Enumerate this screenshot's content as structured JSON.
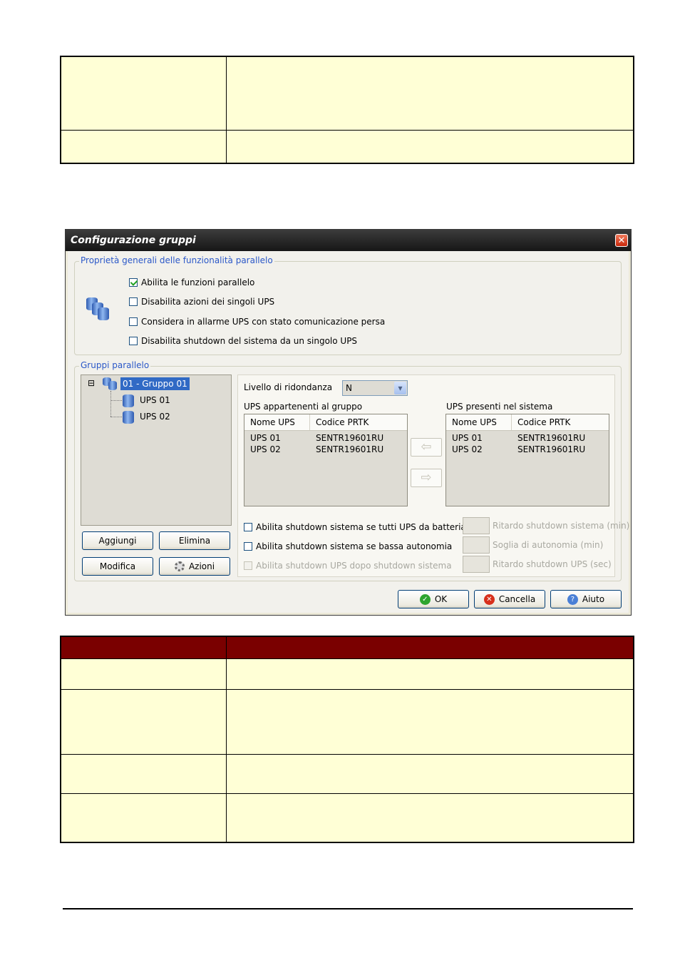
{
  "dialog": {
    "title": "Configurazione gruppi",
    "close_glyph": "✕",
    "general_section": {
      "legend": "Proprietà generali delle funzionalità parallelo",
      "options": [
        {
          "label": "Abilita le funzioni parallelo",
          "checked": true
        },
        {
          "label": "Disabilita azioni dei singoli UPS",
          "checked": false
        },
        {
          "label": "Considera in allarme UPS con stato comunicazione persa",
          "checked": false
        },
        {
          "label": "Disabilita shutdown del sistema da un singolo UPS",
          "checked": false
        }
      ]
    },
    "groups_section": {
      "legend": "Gruppi parallelo",
      "tree": {
        "expander": "⊟",
        "group_label": "01 - Gruppo 01",
        "children": [
          "UPS 01",
          "UPS 02"
        ]
      },
      "buttons": {
        "add": "Aggiungi",
        "delete": "Elimina",
        "edit": "Modifica",
        "actions": "Azioni"
      },
      "redundancy": {
        "label": "Livello di ridondanza",
        "value": "N",
        "dropdown_glyph": "▾"
      },
      "group_list": {
        "caption": "UPS appartenenti al gruppo",
        "columns": [
          "Nome UPS",
          "Codice PRTK"
        ],
        "rows": [
          [
            "UPS 01",
            "SENTR19601RU"
          ],
          [
            "UPS 02",
            "SENTR19601RU"
          ]
        ]
      },
      "system_list": {
        "caption": "UPS presenti nel sistema",
        "columns": [
          "Nome UPS",
          "Codice PRTK"
        ],
        "rows": [
          [
            "UPS 01",
            "SENTR19601RU"
          ],
          [
            "UPS 02",
            "SENTR19601RU"
          ]
        ]
      },
      "move_left_glyph": "⇦",
      "move_right_glyph": "⇨",
      "shutdown_options": [
        {
          "label": "Abilita shutdown sistema se tutti UPS da batteria",
          "checked": false,
          "enabled": true
        },
        {
          "label": "Abilita shutdown sistema se bassa autonomia",
          "checked": false,
          "enabled": true
        },
        {
          "label": "Abilita shutdown UPS dopo shutdown sistema",
          "checked": false,
          "enabled": false
        }
      ],
      "fields": [
        {
          "label": "Ritardo shutdown sistema (min)",
          "value": ""
        },
        {
          "label": "Soglia di autonomia (min)",
          "value": ""
        },
        {
          "label": "Ritardo shutdown UPS (sec)",
          "value": ""
        }
      ]
    },
    "footer": {
      "ok": "OK",
      "cancel": "Cancella",
      "help": "Aiuto"
    }
  },
  "colors": {
    "accent_blue": "#2b58c8",
    "header_red": "#7a0000",
    "table_yellow": "#ffffd6"
  }
}
